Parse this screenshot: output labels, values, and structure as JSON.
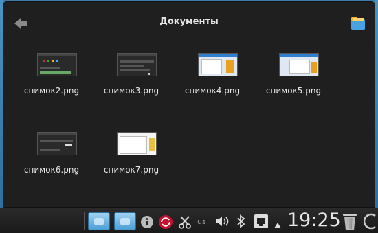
{
  "window": {
    "title": "Документы",
    "back_icon": "arrow-left-icon",
    "folder_icon": "folder-icon"
  },
  "files": [
    {
      "name": "снимок2.png",
      "thumb": "dark"
    },
    {
      "name": "снимок3.png",
      "thumb": "dark"
    },
    {
      "name": "снимок4.png",
      "thumb": "light"
    },
    {
      "name": "снимок5.png",
      "thumb": "light"
    },
    {
      "name": "снимок6.png",
      "thumb": "dark"
    },
    {
      "name": "снимок7.png",
      "thumb": "light-white"
    }
  ],
  "taskbar": {
    "layout_label": "us",
    "clock": "19:25",
    "icons": [
      "folder-icon",
      "folder-icon",
      "info-icon",
      "update-icon",
      "scissors-icon",
      "keyboard-layout-icon",
      "volume-icon",
      "bluetooth-icon",
      "network-icon",
      "tray-arrow-icon",
      "trash-icon",
      "power-icon"
    ]
  },
  "colors": {
    "window_bg": "#1f1f1f",
    "taskbar_bg": "#1a1a1a",
    "text": "#e8e8e8",
    "folder_blue": "#4a9fd6"
  }
}
